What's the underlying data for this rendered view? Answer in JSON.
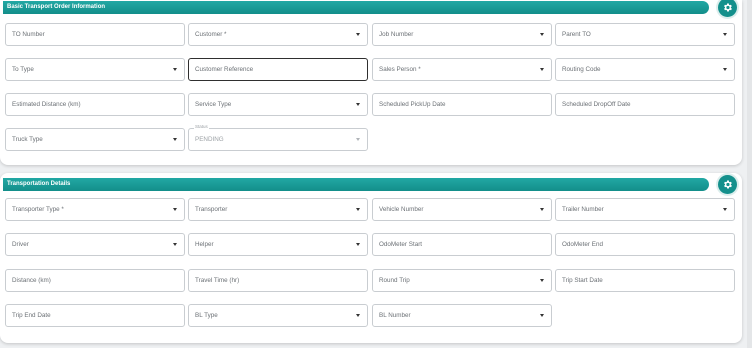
{
  "sections": {
    "basic": {
      "title": "Basic Transport Order Information",
      "fields": {
        "to_number": "TO Number",
        "customer": "Customer *",
        "job_number": "Job Number",
        "parent_to": "Parent TO",
        "to_type": "To Type",
        "customer_reference": "Customer Reference",
        "sales_person": "Sales Person *",
        "routing_code": "Routing Code",
        "estimated_distance": "Estimated Distance (km)",
        "service_type": "Service Type",
        "scheduled_pickup": "Scheduled PickUp Date",
        "scheduled_dropoff": "Scheduled DropOff Date",
        "truck_type": "Truck Type",
        "status_label": "Status",
        "status_value": "PENDING"
      }
    },
    "transport": {
      "title": "Transportation Details",
      "fields": {
        "transporter_type": "Transporter Type *",
        "transporter": "Transporter",
        "vehicle_number": "Vehicle Number",
        "trailer_number": "Trailer Number",
        "driver": "Driver",
        "helper": "Helper",
        "odometer_start": "OdoMeter Start",
        "odometer_end": "OdoMeter End",
        "distance": "Distance (km)",
        "travel_time": "Travel Time (hr)",
        "round_trip": "Round Trip",
        "trip_start_date": "Trip Start Date",
        "trip_end_date": "Trip End Date",
        "bl_type": "BL Type",
        "bl_number": "BL Number"
      }
    }
  },
  "icons": {
    "settings": "gear-icon",
    "dropdown": "chevron-down-icon"
  },
  "colors": {
    "accent": "#14908c",
    "header": "#1a9e9a"
  }
}
